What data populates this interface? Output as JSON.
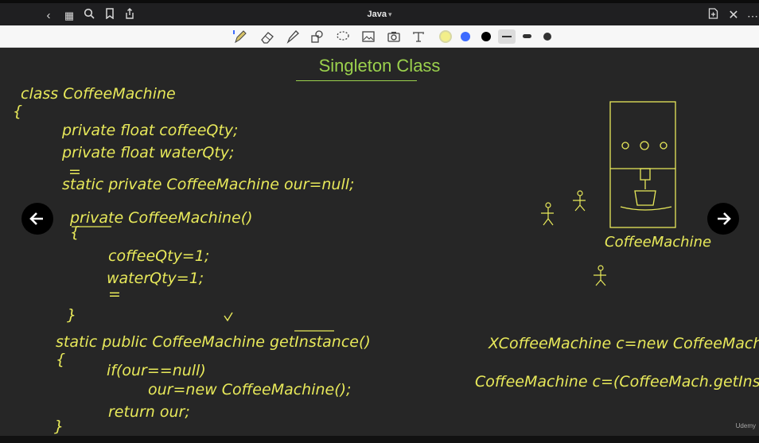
{
  "header": {
    "title": "Java",
    "title_dropdown_icon": "chevron-down-icon"
  },
  "toolbar": {
    "tools": [
      "pen-icon",
      "eraser-icon",
      "highlighter-icon",
      "shapes-icon",
      "lasso-icon",
      "image-icon",
      "camera-icon",
      "text-icon"
    ],
    "colors": [
      "#f3ef8a",
      "#3d6bff",
      "#000000"
    ]
  },
  "canvas": {
    "title": "Singleton Class",
    "code_lines": [
      "class CoffeeMachine",
      "{",
      "private float coffeeQty;",
      "private float waterQty;",
      "=",
      "static private CoffeeMachine our=null;",
      "private CoffeeMachine()",
      "{",
      "coffeeQty=1;",
      "waterQty=1;",
      "=",
      "}",
      "static public CoffeeMachine getInstance()",
      "{",
      "if(our==null)",
      "our=new CoffeeMachine();",
      "return our;",
      "}"
    ],
    "diagram_label": "CoffeeMachine",
    "notes": [
      "XCoffeeMachine c=new CoffeeMach",
      "CoffeeMachine c=(CoffeeMach.getInstan("
    ]
  },
  "watermark": "Udemy"
}
